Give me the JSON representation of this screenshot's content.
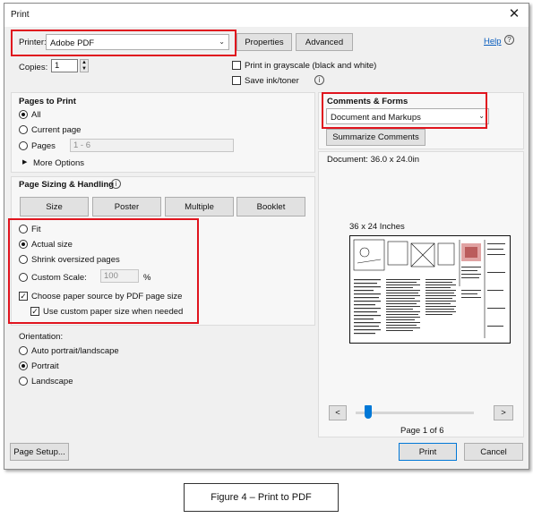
{
  "window": {
    "title": "Print",
    "close_glyph": "✕"
  },
  "printer": {
    "label": "Printer:",
    "value": "Adobe PDF",
    "properties": "Properties",
    "advanced": "Advanced"
  },
  "help": {
    "label": "Help",
    "icon": "?"
  },
  "copies": {
    "label": "Copies:",
    "value": "1"
  },
  "options": {
    "grayscale": "Print in grayscale (black and white)",
    "save_ink": "Save ink/toner",
    "info_icon": "i"
  },
  "pages_to_print": {
    "heading": "Pages to Print",
    "all": "All",
    "current": "Current page",
    "pages": "Pages",
    "pages_value": "1 - 6",
    "more": "More Options"
  },
  "sizing": {
    "heading": "Page Sizing & Handling",
    "tabs": [
      "Size",
      "Poster",
      "Multiple",
      "Booklet"
    ],
    "fit": "Fit",
    "actual": "Actual size",
    "shrink": "Shrink oversized pages",
    "custom": "Custom Scale:",
    "custom_value": "100",
    "percent": "%",
    "choose_source": "Choose paper source by PDF page size",
    "use_custom": "Use custom paper size when needed"
  },
  "orientation": {
    "heading": "Orientation:",
    "auto": "Auto portrait/landscape",
    "portrait": "Portrait",
    "landscape": "Landscape"
  },
  "comments": {
    "heading": "Comments & Forms",
    "value": "Document and Markups",
    "summarize": "Summarize Comments"
  },
  "preview": {
    "document": "Document: 36.0 x 24.0in",
    "size_label": "36 x 24 Inches",
    "page_of": "Page 1 of 6",
    "prev": "<",
    "next": ">"
  },
  "footer": {
    "setup": "Page Setup...",
    "print": "Print",
    "cancel": "Cancel"
  },
  "caption": "Figure 4 – Print to PDF",
  "colors": {
    "highlight": "#e0141e",
    "accent": "#0078d7",
    "link": "#0b5fbf"
  }
}
